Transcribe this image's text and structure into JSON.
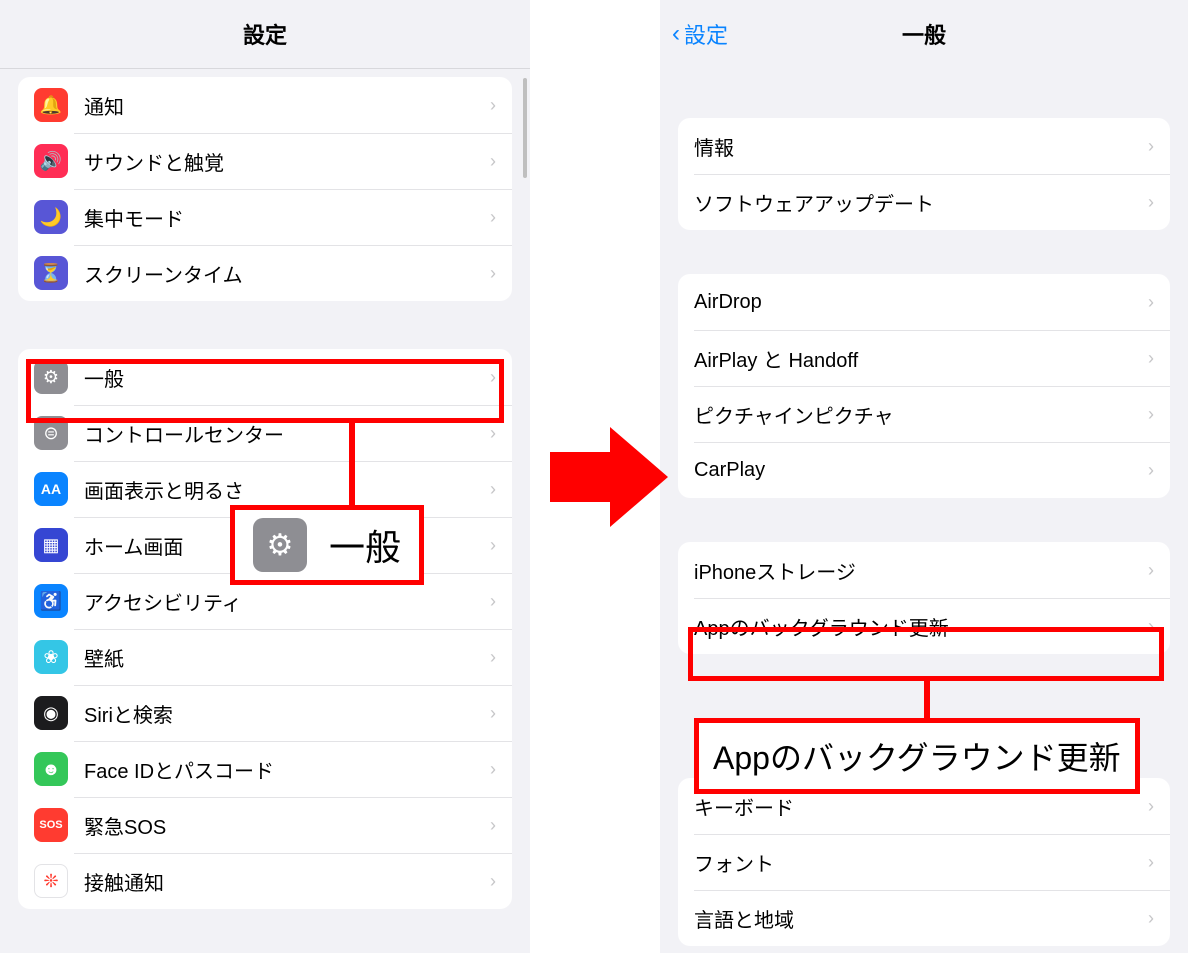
{
  "left": {
    "title": "設定",
    "group1": [
      {
        "label": "通知",
        "icon_bg": "#ff3b30",
        "glyph": "🔔"
      },
      {
        "label": "サウンドと触覚",
        "icon_bg": "#ff2d55",
        "glyph": "🔊"
      },
      {
        "label": "集中モード",
        "icon_bg": "#5856d6",
        "glyph": "🌙"
      },
      {
        "label": "スクリーンタイム",
        "icon_bg": "#5856d6",
        "glyph": "⏳"
      }
    ],
    "group2": [
      {
        "label": "一般",
        "icon_bg": "#8e8e93",
        "glyph": "⚙"
      },
      {
        "label": "コントロールセンター",
        "icon_bg": "#8e8e93",
        "glyph": "⊜"
      },
      {
        "label": "画面表示と明るさ",
        "icon_bg": "#0a84ff",
        "glyph": "AA"
      },
      {
        "label": "ホーム画面",
        "icon_bg": "#3546d3",
        "glyph": "▦"
      },
      {
        "label": "アクセシビリティ",
        "icon_bg": "#0a84ff",
        "glyph": "♿"
      },
      {
        "label": "壁紙",
        "icon_bg": "#34c6e6",
        "glyph": "❀"
      },
      {
        "label": "Siriと検索",
        "icon_bg": "#1c1c1e",
        "glyph": "◉"
      },
      {
        "label": "Face IDとパスコード",
        "icon_bg": "#34c759",
        "glyph": "☻"
      },
      {
        "label": "緊急SOS",
        "icon_bg": "#ff3b30",
        "glyph": "SOS"
      },
      {
        "label": "接触通知",
        "icon_bg": "#ffffff",
        "glyph": "❊",
        "glyph_color": "#ff3b30"
      }
    ]
  },
  "right": {
    "back": "設定",
    "title": "一般",
    "group1": [
      {
        "label": "情報"
      },
      {
        "label": "ソフトウェアアップデート"
      }
    ],
    "group2": [
      {
        "label": "AirDrop"
      },
      {
        "label": "AirPlay と Handoff"
      },
      {
        "label": "ピクチャインピクチャ"
      },
      {
        "label": "CarPlay"
      }
    ],
    "group3": [
      {
        "label": "iPhoneストレージ"
      },
      {
        "label": "Appのバックグラウンド更新"
      }
    ],
    "group4": [
      {
        "label": "キーボード"
      },
      {
        "label": "フォント"
      },
      {
        "label": "言語と地域"
      }
    ]
  },
  "callout_general": "一般",
  "callout_bgapp": "Appのバックグラウンド更新"
}
